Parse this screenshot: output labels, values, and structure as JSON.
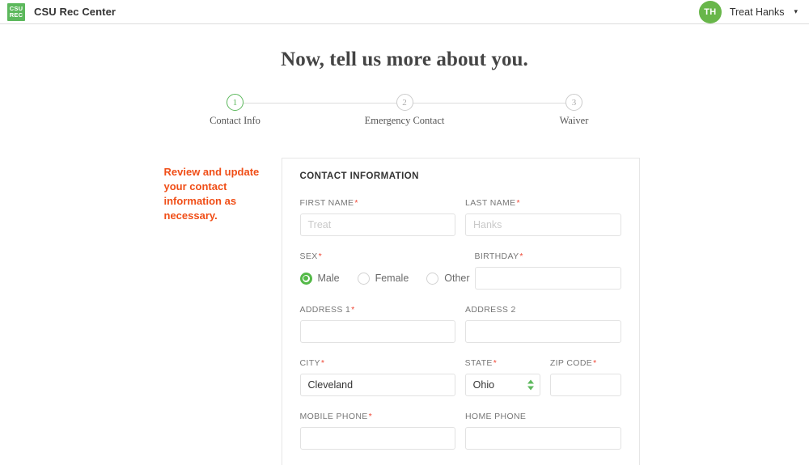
{
  "header": {
    "logo_line1": "CSU",
    "logo_line2": "REC",
    "brand_name": "CSU Rec Center",
    "avatar_initials": "TH",
    "user_name": "Treat Hanks",
    "caret": "▾"
  },
  "page": {
    "title": "Now, tell us more about you."
  },
  "stepper": {
    "steps": [
      {
        "number": "1",
        "label": "Contact Info",
        "active": true
      },
      {
        "number": "2",
        "label": "Emergency Contact",
        "active": false
      },
      {
        "number": "3",
        "label": "Waiver",
        "active": false
      }
    ]
  },
  "aside": {
    "note": "Review and update your contact information as necessary."
  },
  "form": {
    "card_title": "CONTACT INFORMATION",
    "required_mark": "*",
    "fields": {
      "first_name": {
        "label": "FIRST NAME",
        "required": true,
        "value": "",
        "placeholder": "Treat"
      },
      "last_name": {
        "label": "LAST NAME",
        "required": true,
        "value": "",
        "placeholder": "Hanks"
      },
      "sex": {
        "label": "SEX",
        "required": true,
        "selected": "Male",
        "options": [
          "Male",
          "Female",
          "Other"
        ]
      },
      "birthday": {
        "label": "BIRTHDAY",
        "required": true,
        "value": "",
        "placeholder": ""
      },
      "address1": {
        "label": "ADDRESS 1",
        "required": true,
        "value": "",
        "placeholder": ""
      },
      "address2": {
        "label": "ADDRESS 2",
        "required": false,
        "value": "",
        "placeholder": ""
      },
      "city": {
        "label": "CITY",
        "required": true,
        "value": "Cleveland",
        "placeholder": ""
      },
      "state": {
        "label": "STATE",
        "required": true,
        "value": "Ohio",
        "placeholder": ""
      },
      "zip_code": {
        "label": "ZIP CODE",
        "required": true,
        "value": "",
        "placeholder": ""
      },
      "mobile_phone": {
        "label": "MOBILE PHONE",
        "required": true,
        "value": "",
        "placeholder": ""
      },
      "home_phone": {
        "label": "HOME PHONE",
        "required": false,
        "value": "",
        "placeholder": ""
      }
    }
  },
  "colors": {
    "brand_green": "#5cb85c",
    "accent_orange": "#f04e17",
    "required_red": "#ef4836",
    "border_gray": "#e2e2e2"
  }
}
